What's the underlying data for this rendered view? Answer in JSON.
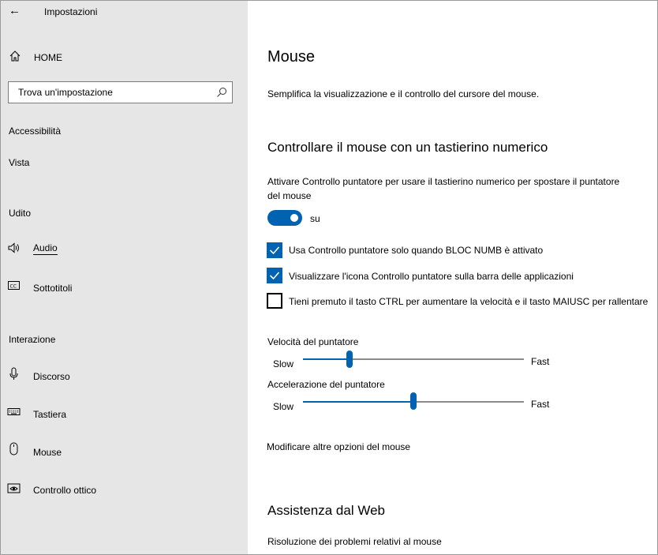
{
  "window": {
    "title": "Impostazioni"
  },
  "sidebar": {
    "home": {
      "label": "HOME",
      "icon": "home-icon"
    },
    "search": {
      "placeholder": "Trova un'impostazione",
      "icon": "search-icon"
    },
    "accessibility": "Accessibilità",
    "vision_header": "Vista",
    "hearing_header": "Udito",
    "hearing_items": [
      {
        "label": "Audio",
        "icon": "speaker-icon"
      },
      {
        "label": "Sottotitoli",
        "icon": "closed-captions-icon"
      }
    ],
    "interaction_header": "Interazione",
    "interaction_items": [
      {
        "label": "Discorso",
        "icon": "microphone-icon"
      },
      {
        "label": "Tastiera",
        "icon": "keyboard-icon"
      },
      {
        "label": "Mouse",
        "icon": "mouse-icon"
      },
      {
        "label": "Controllo ottico",
        "icon": "eye-control-icon"
      }
    ]
  },
  "main": {
    "title": "Mouse",
    "description": "Semplifica la visualizzazione e il controllo del cursore del mouse.",
    "section_keypad": {
      "heading": "Controllare il mouse con un tastierino numerico",
      "toggle_description_line1": "Attivare Controllo puntatore per usare il tastierino numerico per spostare il puntatore",
      "toggle_description_line2": "del mouse",
      "toggle_state": "su",
      "toggle_on": true,
      "checkboxes": [
        {
          "label": "Usa Controllo puntatore solo quando BLOC NUMB è attivato",
          "checked": true
        },
        {
          "label": "Visualizzare l'icona Controllo puntatore sulla barra delle applicazioni",
          "checked": true
        },
        {
          "label": "Tieni premuto il tasto CTRL per aumentare la velocità e il tasto MAIUSC per rallentare",
          "checked": false
        }
      ],
      "speed": {
        "label": "Velocità del puntatore",
        "min_label": "Slow",
        "max_label": "Fast",
        "value_fraction": 0.21
      },
      "acceleration": {
        "label": "Accelerazione del puntatore",
        "min_label": "Slow",
        "max_label": "Fast",
        "value_fraction": 0.5
      },
      "more_options_link": "Modificare altre opzioni del mouse"
    },
    "section_web": {
      "heading": "Assistenza dal Web",
      "link": "Risoluzione dei problemi relativi al mouse"
    }
  },
  "colors": {
    "accent": "#0063b1",
    "sidebar_bg": "#e6e6e6"
  }
}
